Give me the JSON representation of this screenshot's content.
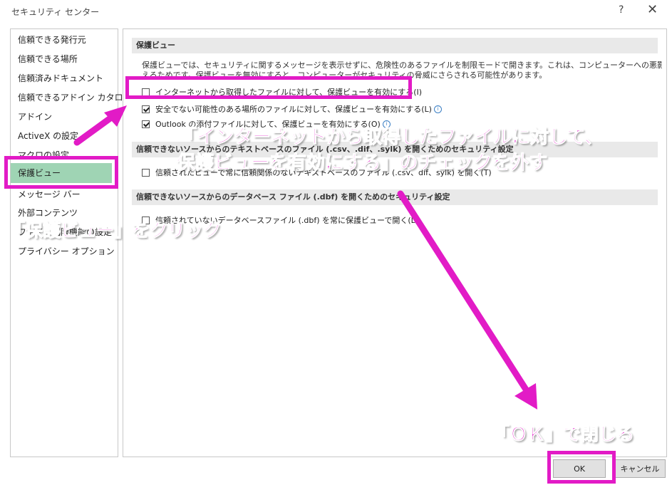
{
  "window": {
    "title": "セキュリティ センター",
    "help_glyph": "?",
    "close_glyph": "✕"
  },
  "nav": {
    "items": [
      "信頼できる発行元",
      "信頼できる場所",
      "信頼済みドキュメント",
      "信頼できるアドイン カタログ",
      "アドイン",
      "ActiveX の設定",
      "マクロの設定",
      "保護ビュー",
      "メッセージ バー",
      "外部コンテンツ",
      "ファイル制限機能の設定",
      "プライバシー オプション"
    ],
    "selected": "保護ビュー"
  },
  "content": {
    "section1": {
      "heading": "保護ビュー",
      "desc_line1": "保護ビューでは、セキュリティに関するメッセージを表示せずに、危険性のあるファイルを制限モードで開きます。これは、コンピューターへの悪影響を最小限に抑",
      "desc_line2": "えるためです。保護ビューを無効にすると、コンピューターがセキュリティの脅威にさらされる可能性があります。",
      "options": [
        {
          "label": "インターネットから取得したファイルに対して、保護ビューを有効にする(I)",
          "checked": false
        },
        {
          "label": "安全でない可能性のある場所のファイルに対して、保護ビューを有効にする(L)",
          "checked": true
        },
        {
          "label": "Outlook の添付ファイルに対して、保護ビューを有効にする(O)",
          "checked": true
        }
      ]
    },
    "section2": {
      "heading": "信頼できないソースからのテキストベースのファイル (.csv、.dif、.sylk) を開くためのセキュリティ設定",
      "option": {
        "label": "信頼されたビューで常に信頼関係のないテキストベースのファイル (.csv、dif、sylk) を開く(T)",
        "checked": false
      }
    },
    "section3": {
      "heading": "信頼できないソースからのデータベース ファイル (.dbf) を開くためのセキュリティ設定",
      "option": {
        "label": "信頼されていないデータベースファイル (.dbf) を常に保護ビューで開く(D)",
        "checked": false
      }
    }
  },
  "buttons": {
    "ok": "OK",
    "cancel": "キャンセル"
  },
  "annotations": {
    "instruction_uncheck_line1": "「インターネットから取得したファイルに対して、",
    "instruction_uncheck_line2": "保護ビューを有効にする」のチェックを外す",
    "instruction_click": "「保護ビュー」をクリック",
    "instruction_ok": "「ＯＫ」で閉じる",
    "accent_color": "#e21bc6"
  }
}
